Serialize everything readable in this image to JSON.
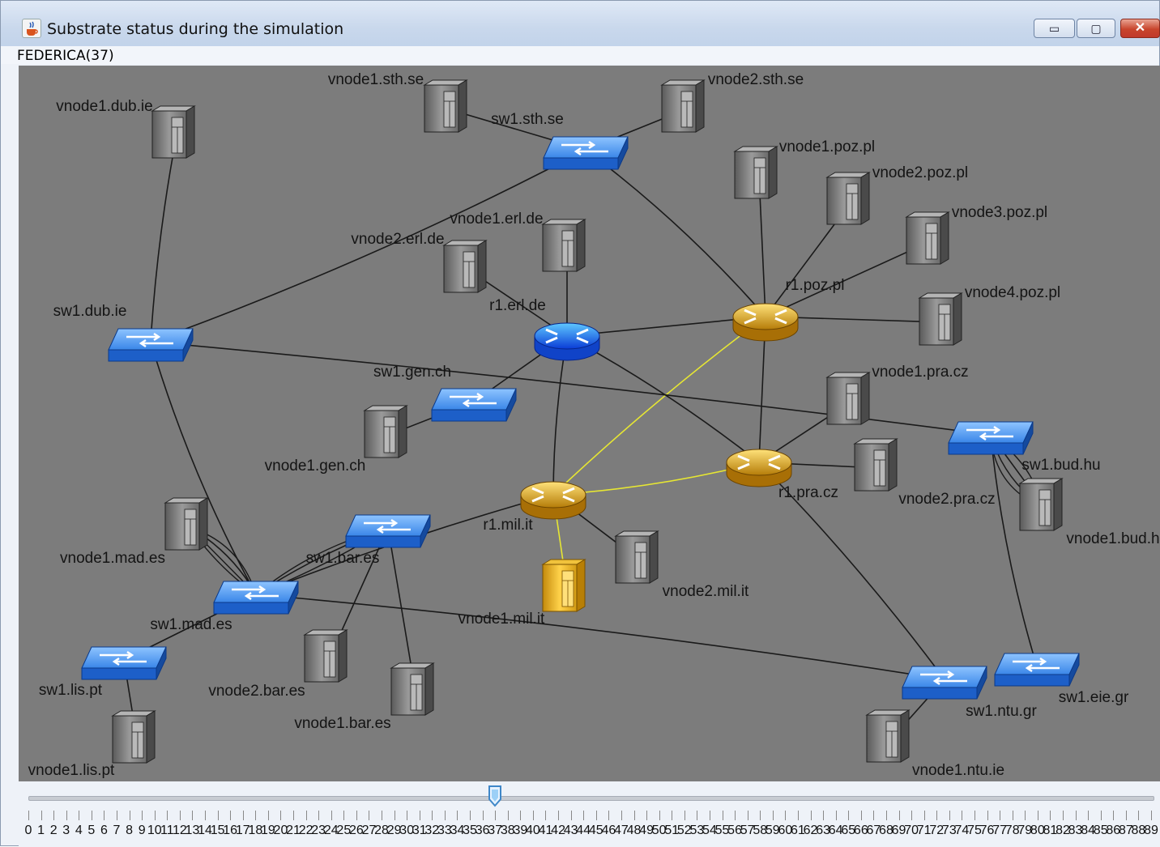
{
  "window": {
    "title": "Substrate status during the simulation",
    "minimize_symbol": "▭",
    "maximize_symbol": "▢",
    "close_symbol": "✕"
  },
  "menu": {
    "label": "FEDERICA(37)"
  },
  "colors": {
    "canvas_bg": "#7c7c7c",
    "edge_default": "#1a1a1a",
    "edge_highlight": "#e6e633",
    "router_active": "#1e73ff",
    "router_normal": "#d8a520",
    "server_highlight": "#e8b21d",
    "switch_blue": "#2a6fd6"
  },
  "graph": {
    "nodes": [
      {
        "id": "vnode1.sth.se",
        "label": "vnode1.sth.se",
        "type": "server"
      },
      {
        "id": "vnode2.sth.se",
        "label": "vnode2.sth.se",
        "type": "server"
      },
      {
        "id": "sw1.sth.se",
        "label": "sw1.sth.se",
        "type": "switch"
      },
      {
        "id": "vnode1.dub.ie",
        "label": "vnode1.dub.ie",
        "type": "server"
      },
      {
        "id": "vnode1.poz.pl",
        "label": "vnode1.poz.pl",
        "type": "server"
      },
      {
        "id": "vnode2.poz.pl",
        "label": "vnode2.poz.pl",
        "type": "server"
      },
      {
        "id": "vnode3.poz.pl",
        "label": "vnode3.poz.pl",
        "type": "server"
      },
      {
        "id": "vnode4.poz.pl",
        "label": "vnode4.poz.pl",
        "type": "server"
      },
      {
        "id": "r1.poz.pl",
        "label": "r1.poz.pl",
        "type": "router"
      },
      {
        "id": "vnode1.erl.de",
        "label": "vnode1.erl.de",
        "type": "server"
      },
      {
        "id": "vnode2.erl.de",
        "label": "vnode2.erl.de",
        "type": "server"
      },
      {
        "id": "r1.erl.de",
        "label": "r1.erl.de",
        "type": "router-active"
      },
      {
        "id": "sw1.dub.ie",
        "label": "sw1.dub.ie",
        "type": "switch"
      },
      {
        "id": "sw1.gen.ch",
        "label": "sw1.gen.ch",
        "type": "switch"
      },
      {
        "id": "vnode1.gen.ch",
        "label": "vnode1.gen.ch",
        "type": "server"
      },
      {
        "id": "vnode1.pra.cz",
        "label": "vnode1.pra.cz",
        "type": "server"
      },
      {
        "id": "sw1.bud.hu",
        "label": "sw1.bud.hu",
        "type": "switch"
      },
      {
        "id": "vnode1.bud.hu",
        "label": "vnode1.bud.h",
        "type": "server"
      },
      {
        "id": "r1.pra.cz",
        "label": "r1.pra.cz",
        "type": "router"
      },
      {
        "id": "vnode2.pra.cz",
        "label": "vnode2.pra.cz",
        "type": "server"
      },
      {
        "id": "r1.mil.it",
        "label": "r1.mil.it",
        "type": "router"
      },
      {
        "id": "vnode1.mil.it",
        "label": "vnode1.mil.it",
        "type": "server-highlight"
      },
      {
        "id": "vnode2.mil.it",
        "label": "vnode2.mil.it",
        "type": "server"
      },
      {
        "id": "vnode1.mad.es",
        "label": "vnode1.mad.es",
        "type": "server"
      },
      {
        "id": "sw1.bar.es",
        "label": "sw1.bar.es",
        "type": "switch"
      },
      {
        "id": "sw1.mad.es",
        "label": "sw1.mad.es",
        "type": "switch"
      },
      {
        "id": "sw1.lis.pt",
        "label": "sw1.lis.pt",
        "type": "switch"
      },
      {
        "id": "vnode1.lis.pt",
        "label": "vnode1.lis.pt",
        "type": "server"
      },
      {
        "id": "vnode2.bar.es",
        "label": "vnode2.bar.es",
        "type": "server"
      },
      {
        "id": "vnode1.bar.es",
        "label": "vnode1.bar.es",
        "type": "server"
      },
      {
        "id": "sw1.ntu.gr",
        "label": "sw1.ntu.gr",
        "type": "switch"
      },
      {
        "id": "sw1.eie.gr",
        "label": "sw1.eie.gr",
        "type": "switch"
      },
      {
        "id": "vnode1.ntu.ie",
        "label": "vnode1.ntu.ie",
        "type": "server"
      }
    ],
    "edges": [
      {
        "from": "vnode1.sth.se",
        "to": "sw1.sth.se",
        "style": "default"
      },
      {
        "from": "vnode2.sth.se",
        "to": "sw1.sth.se",
        "style": "default"
      },
      {
        "from": "sw1.sth.se",
        "to": "r1.poz.pl",
        "style": "default"
      },
      {
        "from": "sw1.sth.se",
        "to": "sw1.dub.ie",
        "style": "default"
      },
      {
        "from": "vnode1.dub.ie",
        "to": "sw1.dub.ie",
        "style": "default"
      },
      {
        "from": "vnode1.poz.pl",
        "to": "r1.poz.pl",
        "style": "default"
      },
      {
        "from": "vnode2.poz.pl",
        "to": "r1.poz.pl",
        "style": "default"
      },
      {
        "from": "vnode3.poz.pl",
        "to": "r1.poz.pl",
        "style": "default"
      },
      {
        "from": "vnode4.poz.pl",
        "to": "r1.poz.pl",
        "style": "default"
      },
      {
        "from": "r1.poz.pl",
        "to": "r1.erl.de",
        "style": "default"
      },
      {
        "from": "r1.poz.pl",
        "to": "r1.pra.cz",
        "style": "default"
      },
      {
        "from": "r1.poz.pl",
        "to": "r1.mil.it",
        "style": "highlight"
      },
      {
        "from": "vnode1.erl.de",
        "to": "r1.erl.de",
        "style": "default"
      },
      {
        "from": "vnode2.erl.de",
        "to": "r1.erl.de",
        "style": "default"
      },
      {
        "from": "r1.erl.de",
        "to": "sw1.gen.ch",
        "style": "default"
      },
      {
        "from": "r1.erl.de",
        "to": "r1.mil.it",
        "style": "default"
      },
      {
        "from": "r1.erl.de",
        "to": "r1.pra.cz",
        "style": "default"
      },
      {
        "from": "sw1.dub.ie",
        "to": "sw1.bud.hu",
        "style": "default"
      },
      {
        "from": "sw1.dub.ie",
        "to": "sw1.mad.es",
        "style": "default"
      },
      {
        "from": "vnode1.gen.ch",
        "to": "sw1.gen.ch",
        "style": "default"
      },
      {
        "from": "vnode1.pra.cz",
        "to": "r1.pra.cz",
        "style": "default"
      },
      {
        "from": "vnode2.pra.cz",
        "to": "r1.pra.cz",
        "style": "default"
      },
      {
        "from": "r1.pra.cz",
        "to": "r1.mil.it",
        "style": "highlight"
      },
      {
        "from": "r1.pra.cz",
        "to": "sw1.ntu.gr",
        "style": "default"
      },
      {
        "from": "sw1.bud.hu",
        "to": "vnode1.bud.hu",
        "style": "default"
      },
      {
        "from": "sw1.bud.hu",
        "to": "sw1.eie.gr",
        "style": "default"
      },
      {
        "from": "r1.mil.it",
        "to": "vnode1.mil.it",
        "style": "highlight"
      },
      {
        "from": "r1.mil.it",
        "to": "vnode2.mil.it",
        "style": "default"
      },
      {
        "from": "r1.mil.it",
        "to": "sw1.mad.es",
        "style": "default"
      },
      {
        "from": "vnode1.mad.es",
        "to": "sw1.mad.es",
        "style": "default"
      },
      {
        "from": "sw1.bar.es",
        "to": "sw1.mad.es",
        "style": "default"
      },
      {
        "from": "sw1.bar.es",
        "to": "vnode2.bar.es",
        "style": "default"
      },
      {
        "from": "sw1.bar.es",
        "to": "vnode1.bar.es",
        "style": "default"
      },
      {
        "from": "sw1.mad.es",
        "to": "sw1.lis.pt",
        "style": "default"
      },
      {
        "from": "sw1.mad.es",
        "to": "sw1.ntu.gr",
        "style": "default"
      },
      {
        "from": "sw1.lis.pt",
        "to": "vnode1.lis.pt",
        "style": "default"
      },
      {
        "from": "sw1.ntu.gr",
        "to": "vnode1.ntu.ie",
        "style": "default"
      }
    ]
  },
  "slider": {
    "min": 0,
    "max": 89,
    "value": 37,
    "tick_labels": [
      "0",
      "1",
      "2",
      "3",
      "4",
      "5",
      "6",
      "7",
      "8",
      "9",
      "10",
      "11",
      "12",
      "13",
      "14",
      "15",
      "16",
      "17",
      "18",
      "19",
      "20",
      "21",
      "22",
      "23",
      "24",
      "25",
      "26",
      "27",
      "28",
      "29",
      "30",
      "31",
      "32",
      "33",
      "34",
      "35",
      "36",
      "37",
      "38",
      "39",
      "40",
      "41",
      "42",
      "43",
      "44",
      "45",
      "46",
      "47",
      "48",
      "49",
      "50",
      "51",
      "52",
      "53",
      "54",
      "55",
      "56",
      "57",
      "58",
      "59",
      "60",
      "61",
      "62",
      "63",
      "64",
      "65",
      "66",
      "67",
      "68",
      "69",
      "70",
      "71",
      "72",
      "73",
      "74",
      "75",
      "76",
      "77",
      "78",
      "79",
      "80",
      "81",
      "82",
      "83",
      "84",
      "85",
      "86",
      "87",
      "88",
      "89"
    ]
  }
}
